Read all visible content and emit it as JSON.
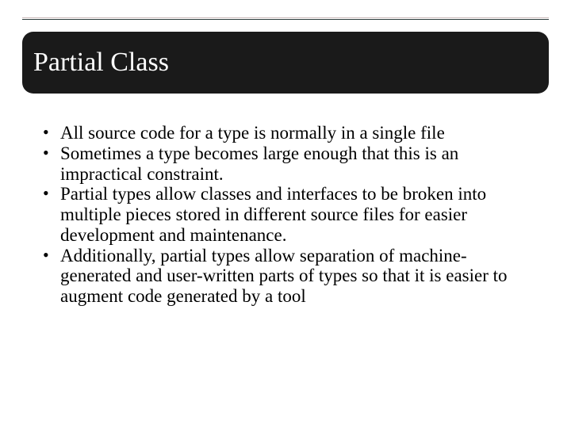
{
  "slide": {
    "title": "Partial Class",
    "bullets": [
      "All source code for a type is normally in a single file",
      "Sometimes a type becomes large enough that this is an impractical constraint.",
      "Partial types allow classes and interfaces to be broken into multiple pieces stored in different source files for easier development and maintenance.",
      "Additionally, partial types allow separation of machine-generated and user-written parts of types so that it is easier to augment code generated by a tool"
    ]
  }
}
